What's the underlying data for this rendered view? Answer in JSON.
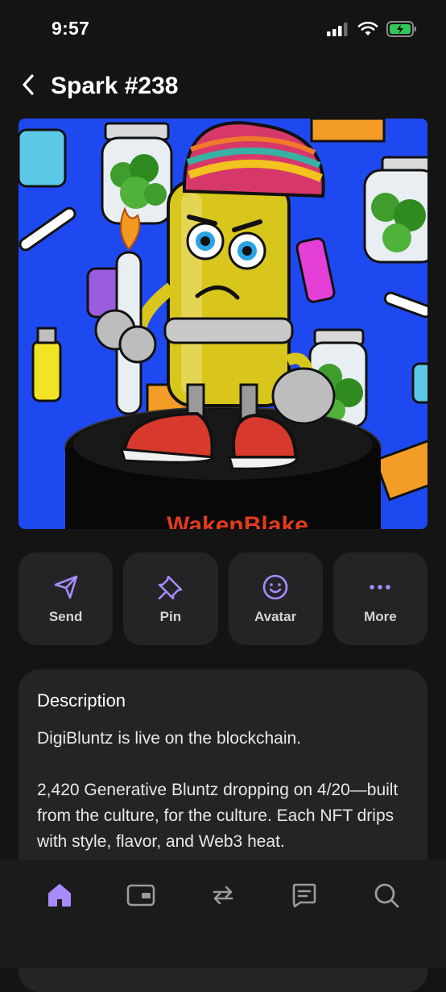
{
  "status_bar": {
    "time": "9:57"
  },
  "header": {
    "title": "Spark #238"
  },
  "nft": {
    "banner_text": "WakenBlake"
  },
  "actions": [
    {
      "label": "Send",
      "icon": "send-icon"
    },
    {
      "label": "Pin",
      "icon": "pin-icon"
    },
    {
      "label": "Avatar",
      "icon": "smile-icon"
    },
    {
      "label": "More",
      "icon": "more-icon"
    }
  ],
  "description": {
    "title": "Description",
    "body": "DigiBluntz is live on the blockchain.\n\n2,420 Generative Bluntz dropping on 4/20—built from the culture, for the culture. Each NFT drips with style, flavor, and Web3 heat."
  },
  "tab_bar": {
    "items": [
      "home-icon",
      "wallet-icon",
      "swap-icon",
      "chat-icon",
      "search-icon"
    ],
    "active_index": 0
  },
  "colors": {
    "accent": "#a78bfa",
    "background": "#141414",
    "card": "#242426",
    "nft_background": "#1f49f0"
  }
}
